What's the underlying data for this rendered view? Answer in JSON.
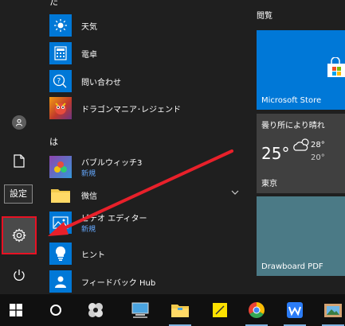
{
  "start_menu": {
    "rail": {
      "settings_tooltip": "設定"
    },
    "app_list": {
      "section_top_letter": "た",
      "section_ha_letter": "は",
      "apps": [
        {
          "name": "天気",
          "sub": "",
          "icon": "sun-icon",
          "color": "#0078d7"
        },
        {
          "name": "電卓",
          "sub": "",
          "icon": "calculator-icon",
          "color": "#0078d7"
        },
        {
          "name": "問い合わせ",
          "sub": "",
          "icon": "person-question-icon",
          "color": "#0078d7"
        },
        {
          "name": "ドラゴンマニア･レジェンド",
          "sub": "",
          "icon": "dragon-game-icon",
          "color": "#c0392b"
        },
        {
          "name": "バブルウィッチ3",
          "sub": "新規",
          "icon": "bubble-witch-icon",
          "color": "#6a3fb5"
        },
        {
          "name": "微信",
          "sub": "",
          "icon": "folder-icon",
          "color": "#0078d7"
        },
        {
          "name": "ビデオ エディター",
          "sub": "新規",
          "icon": "photo-icon",
          "color": "#0078d7"
        },
        {
          "name": "ヒント",
          "sub": "",
          "icon": "lightbulb-icon",
          "color": "#0078d7"
        },
        {
          "name": "フィードバック Hub",
          "sub": "",
          "icon": "feedback-icon",
          "color": "#0078d7"
        }
      ]
    },
    "tiles": {
      "heading": "閲覧",
      "store_label": "Microsoft Store",
      "weather": {
        "condition": "曇り所により晴れ",
        "temp": "25°",
        "high": "28°",
        "low": "20°",
        "city": "東京"
      },
      "drawboard_label": "Drawboard PDF"
    }
  },
  "taskbar": {
    "items": [
      "start-windows-icon",
      "cortana-circle-icon",
      "game-app-icon",
      "computer-icon",
      "file-explorer-icon",
      "sticky-notes-icon",
      "chrome-icon",
      "wps-icon",
      "photos-app-icon"
    ]
  },
  "colors": {
    "accent_blue": "#0078d7",
    "highlight_red": "#e81123",
    "arrow_red": "#e8202a",
    "new_badge_blue": "#65a9ff"
  }
}
